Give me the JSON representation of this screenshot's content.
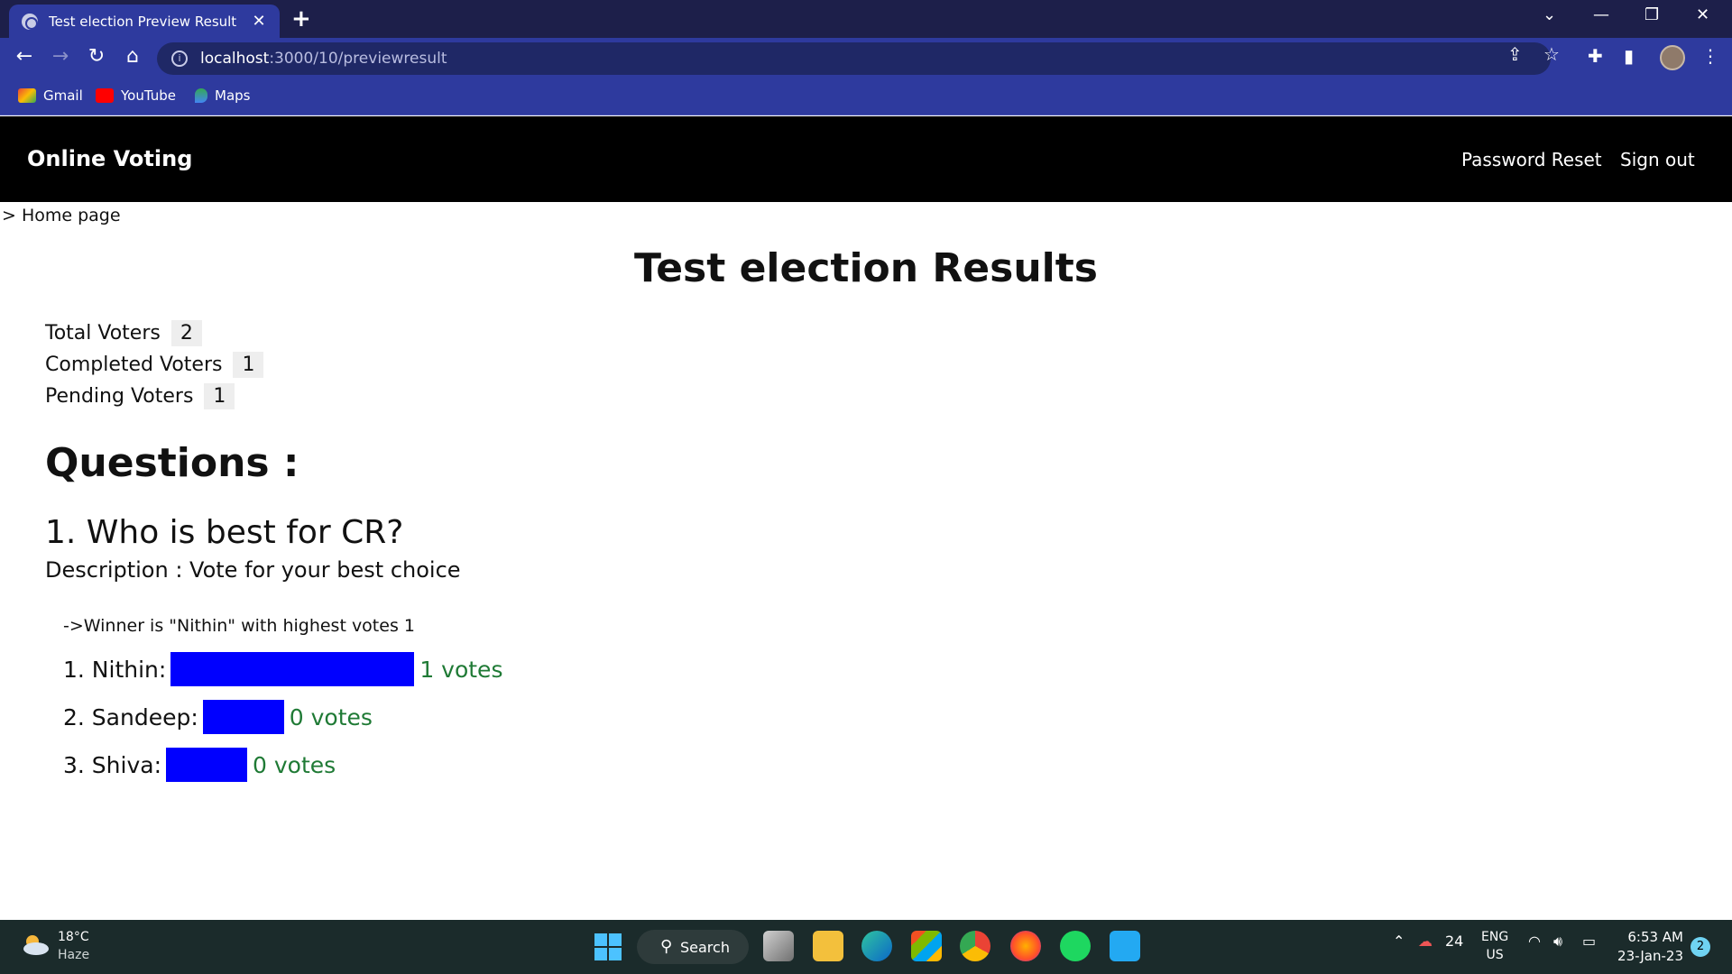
{
  "browser": {
    "tab_title": "Test election Preview Result",
    "url_host": "localhost",
    "url_path": ":3000/10/previewresult",
    "bookmarks": [
      "Gmail",
      "YouTube",
      "Maps"
    ]
  },
  "app": {
    "brand": "Online Voting",
    "nav_links": [
      "Password Reset",
      "Sign out"
    ],
    "breadcrumb": "> Home page",
    "page_title": "Test election Results",
    "stats": [
      {
        "label": "Total Voters",
        "value": "2"
      },
      {
        "label": "Completed Voters",
        "value": "1"
      },
      {
        "label": "Pending Voters",
        "value": "1"
      }
    ],
    "questions_heading": "Questions :",
    "question": {
      "title": "1. Who is best for CR?",
      "description": "Description : Vote for your best choice",
      "winner_text": "->Winner is \"Nithin\" with highest votes 1",
      "options": [
        {
          "label": "1. Nithin:",
          "votes": "1 votes",
          "share": 1.0
        },
        {
          "label": "2. Sandeep:",
          "votes": "0 votes",
          "share": 0
        },
        {
          "label": "3. Shiva:",
          "votes": "0 votes",
          "share": 0
        }
      ]
    }
  },
  "taskbar": {
    "temp": "18°C",
    "condition": "Haze",
    "search": "Search",
    "tray_count": "24",
    "lang": "ENG",
    "region": "US",
    "time": "6:53 AM",
    "date": "23-Jan-23",
    "notifications": "2"
  },
  "colors": {
    "bar": "#0000ff",
    "votes_text": "#1f7a35",
    "navbar": "#000000"
  }
}
